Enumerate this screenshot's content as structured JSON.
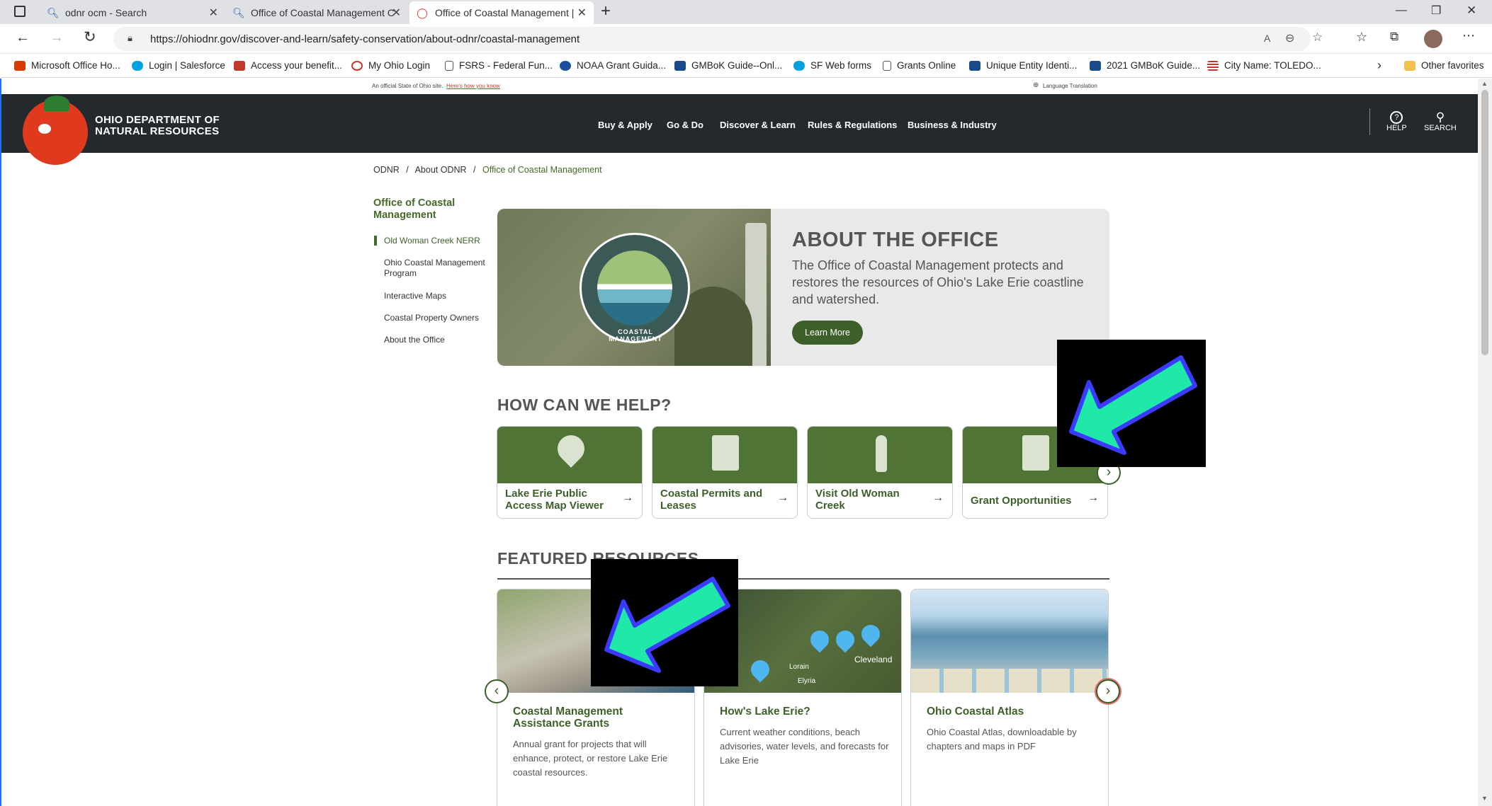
{
  "browser": {
    "tabs": [
      {
        "title": "odnr ocm - Search",
        "icon": "search-icon"
      },
      {
        "title": "Office of Coastal Management C",
        "icon": "search-icon"
      },
      {
        "title": "Office of Coastal Management |",
        "icon": "ohio-icon"
      }
    ],
    "new_tab_symbol": "+",
    "url": "https://ohiodnr.gov/discover-and-learn/safety-conservation/about-odnr/coastal-management",
    "bookmarks": [
      "Microsoft Office Ho...",
      "Login | Salesforce",
      "Access your benefit...",
      "My Ohio Login",
      "FSRS - Federal Fun...",
      "NOAA Grant Guida...",
      "GMBoK Guide--Onl...",
      "SF Web forms",
      "Grants Online",
      "Unique Entity Identi...",
      "2021 GMBoK Guide...",
      "City Name: TOLEDO..."
    ],
    "other_favorites": "Other favorites"
  },
  "state_bar": {
    "official_text": "An official State of Ohio site.",
    "how_link": "Here's how you know",
    "language": "Language Translation"
  },
  "header": {
    "org_line1": "OHIO DEPARTMENT OF",
    "org_line2": "NATURAL RESOURCES",
    "nav": [
      "Buy & Apply",
      "Go & Do",
      "Discover & Learn",
      "Rules & Regulations",
      "Business & Industry"
    ],
    "help_label": "HELP",
    "search_label": "SEARCH"
  },
  "breadcrumb": {
    "items": [
      "ODNR",
      "About ODNR",
      "Office of Coastal Management"
    ],
    "separator": "/"
  },
  "sidebar": {
    "title": "Office of Coastal Management",
    "items": [
      "Old Woman Creek NERR",
      "Ohio Coastal Management Program",
      "Interactive Maps",
      "Coastal Property Owners",
      "About the Office"
    ]
  },
  "hero": {
    "heading": "ABOUT THE OFFICE",
    "body": "The Office of Coastal Management protects and restores the resources of Ohio's Lake Erie coastline and watershed.",
    "button": "Learn More",
    "seal_text": "COASTAL MANAGEMENT"
  },
  "help": {
    "heading": "HOW CAN WE HELP?",
    "cards": [
      {
        "label": "Lake Erie Public Access Map Viewer",
        "icon": "map-pin-icon"
      },
      {
        "label": "Coastal Permits and Leases",
        "icon": "document-icon"
      },
      {
        "label": "Visit Old Woman Creek",
        "icon": "heron-icon"
      },
      {
        "label": "Grant Opportunities",
        "icon": "document-icon"
      }
    ]
  },
  "featured": {
    "heading": "FEATURED RESOURCES",
    "cards": [
      {
        "title": "Coastal Management Assistance Grants",
        "desc": "Annual grant for projects that will enhance, protect, or restore Lake Erie coastal resources."
      },
      {
        "title": "How's Lake Erie?",
        "desc": "Current weather conditions, beach advisories, water levels, and forecasts for Lake Erie",
        "map_labels": [
          "Cleveland",
          "Lorain",
          "Elyria"
        ]
      },
      {
        "title": "Ohio Coastal Atlas",
        "desc": "Ohio Coastal Atlas, downloadable by chapters and maps in PDF"
      }
    ]
  },
  "colors": {
    "header_bg": "#24292d",
    "brand_green": "#3d5f2a",
    "card_green": "#4f7436",
    "arrow_fill": "#1fe8a8",
    "arrow_stroke": "#3b3bff"
  }
}
